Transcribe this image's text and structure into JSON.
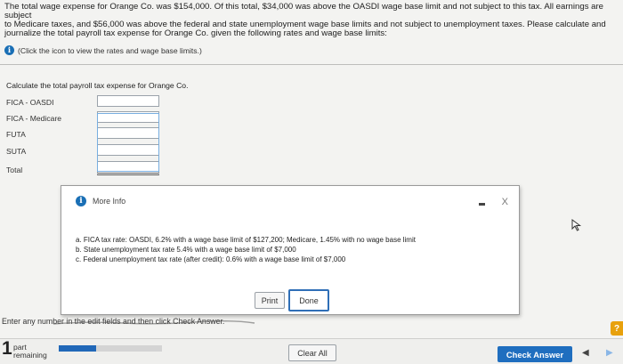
{
  "problem": {
    "line1": "The total wage expense for Orange Co. was $154,000. Of this total, $34,000 was above the OASDI wage base limit and not subject to this tax. All earnings are subject",
    "line2": "to Medicare taxes, and $56,000 was above the federal and state unemployment wage base limits and not subject to unemployment taxes. Please calculate and",
    "line3": "journalize the total payroll tax expense for Orange Co. given the following rates and wage base limits:",
    "hint": "(Click the icon to view the rates and wage base limits.)"
  },
  "calc": {
    "title": "Calculate the total payroll tax expense for Orange Co.",
    "rows": [
      {
        "label": "FICA - OASDI",
        "value": ""
      },
      {
        "label": "FICA - Medicare",
        "value": ""
      },
      {
        "label": "FUTA",
        "value": ""
      },
      {
        "label": "SUTA",
        "value": ""
      },
      {
        "label": "Total",
        "value": ""
      }
    ]
  },
  "modal": {
    "title": "More Info",
    "line_a": "a. FICA tax rate: OASDI, 6.2% with a wage base limit of $127,200; Medicare, 1.45% with no wage base limit",
    "line_b": "b. State unemployment tax rate 5.4% with a wage base limit of $7,000",
    "line_c": "c. Federal unemployment tax rate (after credit): 0.6% with a wage base limit of $7,000",
    "print": "Print",
    "done": "Done",
    "close_glyph": "X"
  },
  "instruction": "Enter any number in the edit fields and then click Check Answer.",
  "help_glyph": "?",
  "footer": {
    "part_number": "1",
    "part_line1": "part",
    "part_line2": "remaining",
    "progress_fraction": 0.36,
    "clear_all": "Clear All",
    "check_answer": "Check Answer"
  },
  "colors": {
    "accent": "#1f6ebf",
    "help": "#e8a10d"
  }
}
